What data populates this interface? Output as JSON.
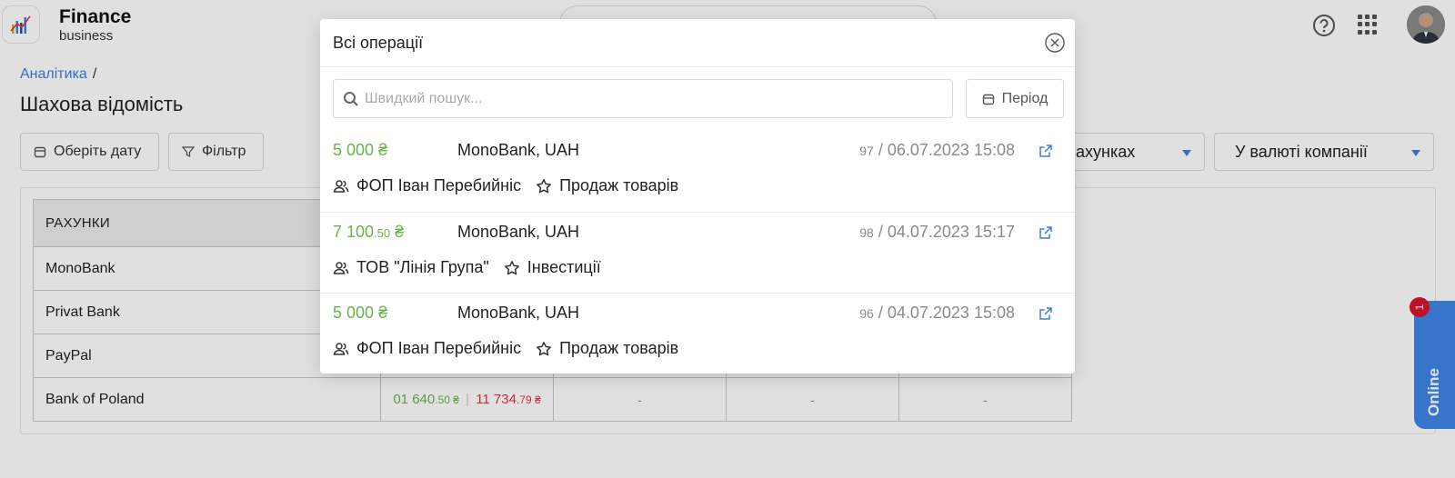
{
  "header": {
    "brand_title": "Finance",
    "brand_subtitle": "business",
    "icons": [
      "logo-chart-icon",
      "help-icon",
      "apps-grid-icon",
      "avatar"
    ]
  },
  "breadcrumb": {
    "link": "Аналітика",
    "separator": "/"
  },
  "page_title": "Шахова відомість",
  "toolbar": {
    "date_button": "Оберіть дату",
    "filter_button": "Фільтр",
    "accounts_select": "ахунках",
    "currency_select": "У валюті компанії"
  },
  "table": {
    "header": "РАХУНКИ",
    "rows": [
      {
        "name": "MonoBank"
      },
      {
        "name": "Privat Bank"
      },
      {
        "name": "PayPal"
      },
      {
        "name": "Bank of Poland",
        "income_main": "01 640",
        "income_cents": ".50 ₴",
        "expense_main": "11 734",
        "expense_cents": ".79 ₴",
        "c1": "-",
        "c2": "-",
        "c3": "-"
      }
    ]
  },
  "online_widget": {
    "label": "Online",
    "badge": "1"
  },
  "modal": {
    "title": "Всі операції",
    "search_placeholder": "Швидкий пошук...",
    "period_button": "Період",
    "operations": [
      {
        "amount_main": "5 000",
        "amount_cents": "",
        "currency_sign": "₴",
        "bank": "MonoBank, UAH",
        "number": "97",
        "datetime": "06.07.2023 15:08",
        "counterparty": "ФОП Іван Перебийніс",
        "category": "Продаж товарів"
      },
      {
        "amount_main": "7 100",
        "amount_cents": ".50",
        "currency_sign": "₴",
        "bank": "MonoBank, UAH",
        "number": "98",
        "datetime": "04.07.2023 15:17",
        "counterparty": "ТОВ \"Лінія Група\"",
        "category": "Інвестиції"
      },
      {
        "amount_main": "5 000",
        "amount_cents": "",
        "currency_sign": "₴",
        "bank": "MonoBank, UAH",
        "number": "96",
        "datetime": "04.07.2023 15:08",
        "counterparty": "ФОП Іван Перебийніс",
        "category": "Продаж товарів"
      }
    ]
  },
  "colors": {
    "accent": "#3f7ee0",
    "income": "#68b34a",
    "expense": "#e2344a",
    "online": "#3f86e6",
    "badge": "#d9142b"
  }
}
